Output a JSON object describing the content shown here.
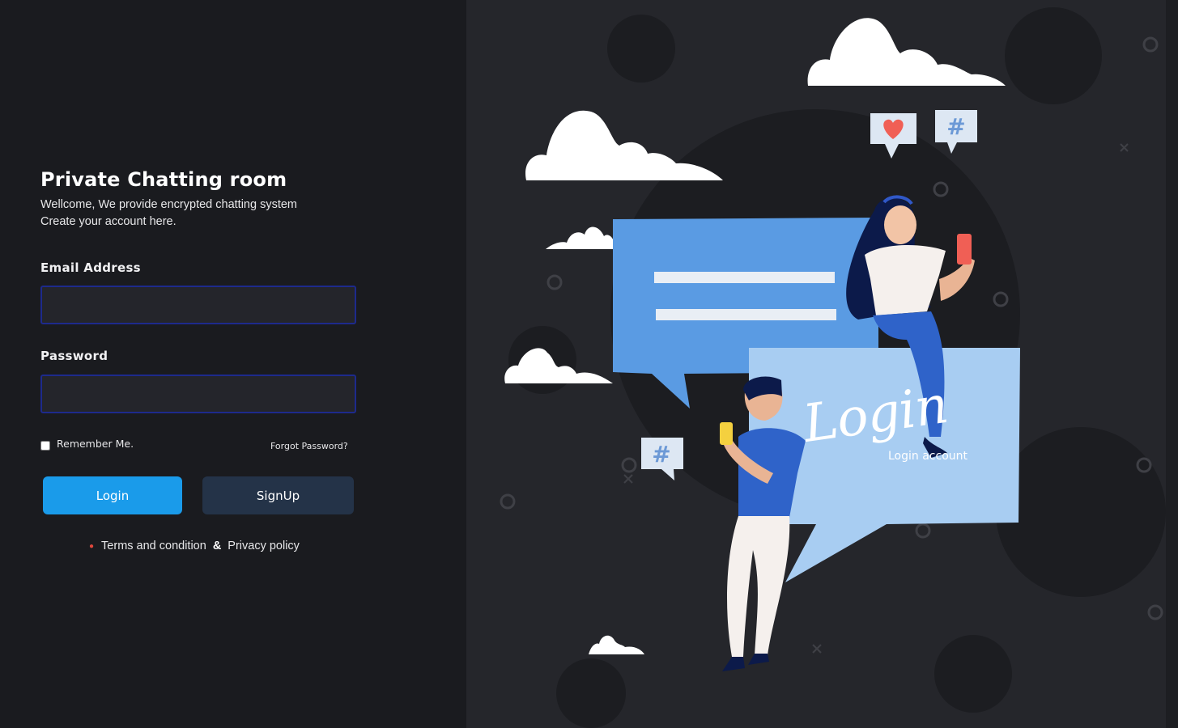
{
  "page": {
    "title": "Private Chatting room",
    "subtitle_line1": "Wellcome, We provide encrypted chatting system",
    "subtitle_line2": "Create your account here."
  },
  "form": {
    "email_label": "Email Address",
    "email_value": "",
    "password_label": "Password",
    "password_value": "",
    "remember_label": "Remember Me.",
    "remember_checked": false,
    "forgot_label": "Forgot Password?",
    "login_button": "Login",
    "signup_button": "SignUp"
  },
  "footer": {
    "terms_label": "Terms and condition",
    "separator": "&",
    "privacy_label": "Privacy policy"
  },
  "illustration": {
    "script_text": "Login",
    "caption": "Login account",
    "colors": {
      "panel_bg": "#25262b",
      "bubble_dark_blue": "#5a9be3",
      "bubble_light_blue": "#a8cdf2",
      "accent_blue": "#1a9bea"
    }
  }
}
